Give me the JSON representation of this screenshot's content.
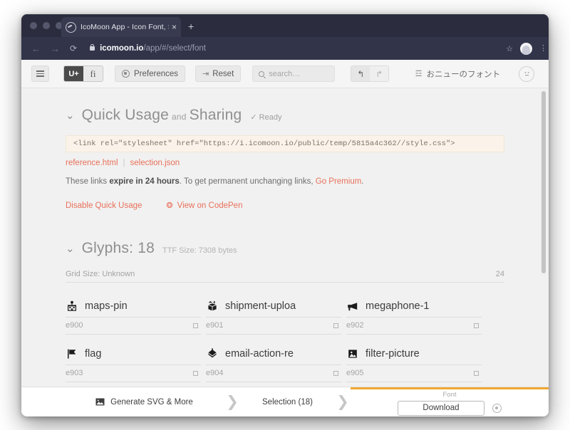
{
  "browser": {
    "tab": {
      "title": "IcoMoon App - Icon Font, SVG",
      "favicon": "icomoon-favicon-icon",
      "close": "×"
    },
    "new_tab": "+",
    "nav": {
      "back": "←",
      "forward": "→",
      "reload": "⟳"
    },
    "url": {
      "host": "icomoon.io",
      "path": "/app/#/select/font",
      "lock": "lock-icon"
    },
    "star": "☆",
    "menu": "⋮"
  },
  "toolbar": {
    "menu_button": "hamburger-icon",
    "segmented": [
      {
        "label": "U+",
        "active": true
      },
      {
        "label": "fi",
        "active": false
      }
    ],
    "preferences": "Preferences",
    "reset": "Reset",
    "reset_icon": "⇥",
    "search_placeholder": "search…",
    "search_value": "",
    "undo": "↰",
    "redo": "↱",
    "project_name": "おニューのフォント",
    "project_icon": "library-icon",
    "face_icon": "😐"
  },
  "quick_usage": {
    "chevron": "⌄",
    "title": "Quick Usage",
    "conjunction": "and",
    "title2": "Sharing",
    "status_check": "✓",
    "status": "Ready",
    "code": "<link rel=\"stylesheet\" href=\"https://i.icomoon.io/public/temp/5815a4c362//style.css\">",
    "links": [
      "reference.html",
      "selection.json"
    ],
    "link_separator": "|",
    "note_prefix": "These links ",
    "note_bold": "expire in 24 hours",
    "note_mid": ". To get permanent unchanging links, ",
    "note_premium": "Go Premium",
    "note_suffix": ".",
    "disable_quick_usage": "Disable Quick Usage",
    "view_on_codepen": "View on CodePen",
    "codepen_icon": "codepen-icon"
  },
  "glyphs_section": {
    "chevron": "⌄",
    "title": "Glyphs: 18",
    "meta": "TTF Size: 7308 bytes",
    "grid_size_label": "Grid Size: Unknown",
    "grid_size_value": "24",
    "glyphs": [
      {
        "icon": "maps-pin-icon",
        "name": "maps-pin",
        "code": "e900"
      },
      {
        "icon": "shipment-upload-icon",
        "name": "shipment-uploa",
        "code": "e901"
      },
      {
        "icon": "megaphone-icon",
        "name": "megaphone-1",
        "code": "e902"
      },
      {
        "icon": "flag-icon",
        "name": "flag",
        "code": "e903"
      },
      {
        "icon": "email-action-icon",
        "name": "email-action-re",
        "code": "e904"
      },
      {
        "icon": "filter-picture-icon",
        "name": "filter-picture",
        "code": "e905"
      }
    ]
  },
  "bottom_bar": {
    "generate": "Generate SVG & More",
    "generate_icon": "image-icon",
    "selection": "Selection (18)",
    "arrow": "❯",
    "font_label": "Font",
    "download": "Download",
    "settings_icon": "gear-icon",
    "accent_color": "#f0a830"
  }
}
